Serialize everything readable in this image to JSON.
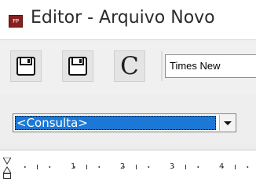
{
  "window": {
    "app_icon_text": "FP",
    "title": "Editor - Arquivo Novo"
  },
  "toolbar": {
    "save_icon": "floppy-disk-icon",
    "save_as_icon": "floppy-disk-icon",
    "clear_label": "C",
    "font_name": "Times New"
  },
  "query": {
    "selected": "<Consulta>",
    "arrow_icon": "chevron-down-icon"
  },
  "ruler": {
    "numbers": [
      "1",
      "2",
      "3",
      "4"
    ]
  }
}
